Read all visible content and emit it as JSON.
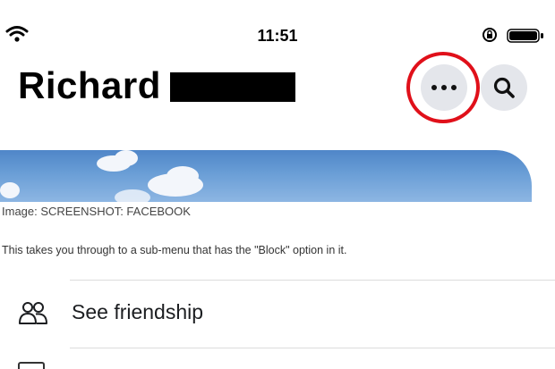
{
  "status_bar": {
    "time": "11:51",
    "icons": [
      "wifi-icon",
      "orientation-lock-icon",
      "battery-icon"
    ]
  },
  "header": {
    "name": "Richard",
    "more_icon": "more-horizontal-icon",
    "search_icon": "search-icon",
    "highlight_color": "#e0101a"
  },
  "article": {
    "caption": "Image: SCREENSHOT: FACEBOOK",
    "body": "This takes you through to a sub-menu that has the \"Block\" option in it."
  },
  "menu": {
    "items": [
      {
        "label": "See friendship",
        "icon": "friends-icon"
      }
    ]
  },
  "colors": {
    "button_bg": "#e4e6eb",
    "accent_red": "#e0101a"
  }
}
